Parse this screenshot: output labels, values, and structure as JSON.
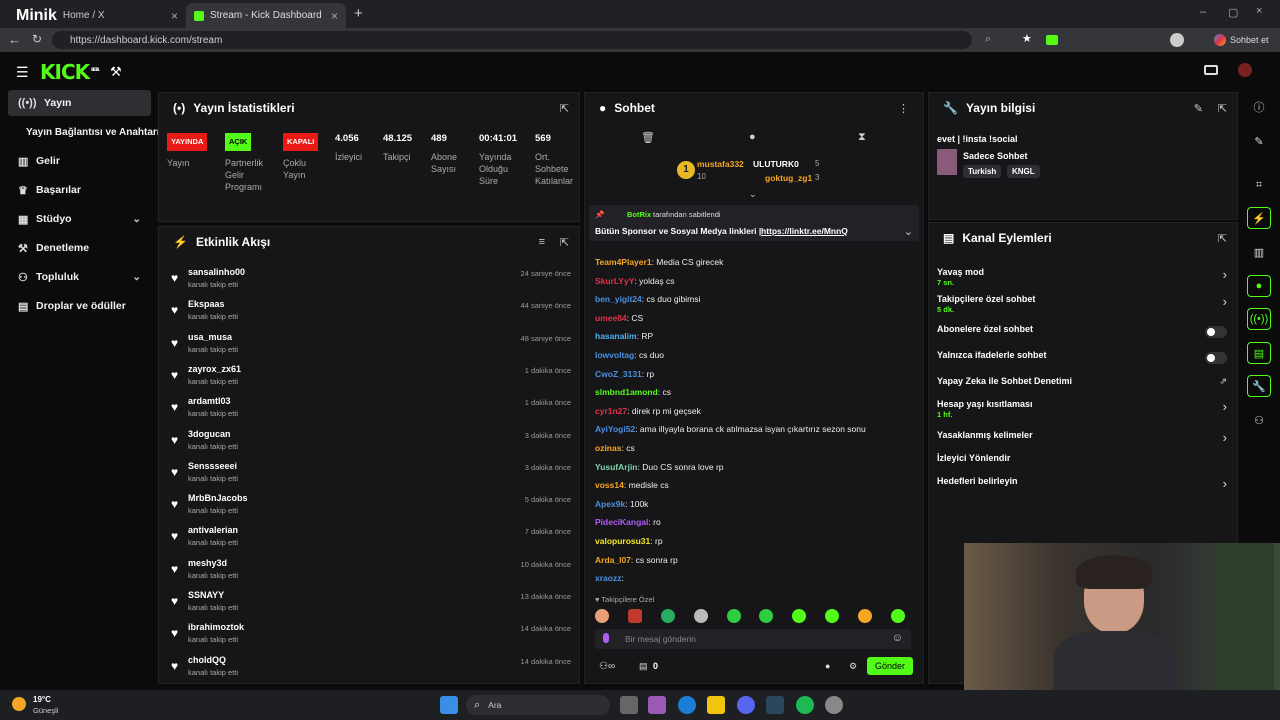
{
  "browser": {
    "tabs": [
      {
        "label": "Home / X",
        "overlay": "Minik"
      },
      {
        "label": "Stream - Kick Dashboard"
      }
    ],
    "url": "https://dashboard.kick.com/stream",
    "profile_label": "Sohbet et"
  },
  "header": {
    "logo": "KICK",
    "logo_badge": "BETA"
  },
  "sidebar": {
    "items": [
      {
        "label": "Yayın",
        "icon": "broadcast-icon"
      },
      {
        "label": "Yayın Bağlantısı ve Anahtarı",
        "icon": ""
      },
      {
        "label": "Gelir",
        "icon": "chart-icon"
      },
      {
        "label": "Başarılar",
        "icon": "trophy-icon"
      },
      {
        "label": "Stüdyo",
        "icon": "studio-icon"
      },
      {
        "label": "Denetleme",
        "icon": "hammer-icon"
      },
      {
        "label": "Topluluk",
        "icon": "community-icon"
      },
      {
        "label": "Droplar ve ödüller",
        "icon": "gift-icon"
      }
    ]
  },
  "stats": {
    "title": "Yayın İstatistikleri",
    "items": [
      {
        "badge": "YAYINDA",
        "label": "Yayın"
      },
      {
        "badge": "AÇIK",
        "label": "Partnerlik Gelir Programı"
      },
      {
        "badge": "KAPALI",
        "label": "Çoklu Yayın"
      },
      {
        "value": "4.056",
        "label": "İzleyici"
      },
      {
        "value": "48.125",
        "label": "Takipçi"
      },
      {
        "value": "489",
        "label": "Abone Sayısı"
      },
      {
        "value": "00:41:01",
        "label": "Yayında Olduğu Süre"
      },
      {
        "value": "569",
        "label": "Ort. Sohbete Katılanlar"
      }
    ]
  },
  "activity": {
    "title": "Etkinlik Akışı",
    "subtext": "kanalı takip etti",
    "events": [
      {
        "name": "sansalinho00",
        "time": "24 saniye önce"
      },
      {
        "name": "Ekspaas",
        "time": "44 saniye önce"
      },
      {
        "name": "usa_musa",
        "time": "48 saniye önce"
      },
      {
        "name": "zayrox_zx61",
        "time": "1 dakika önce"
      },
      {
        "name": "ardamtl03",
        "time": "1 dakika önce"
      },
      {
        "name": "3dogucan",
        "time": "3 dakika önce"
      },
      {
        "name": "Senssseeei",
        "time": "3 dakika önce"
      },
      {
        "name": "MrbBnJacobs",
        "time": "5 dakika önce"
      },
      {
        "name": "antivalerian",
        "time": "7 dakika önce"
      },
      {
        "name": "meshy3d",
        "time": "10 dakika önce"
      },
      {
        "name": "SSNAYY",
        "time": "13 dakika önce"
      },
      {
        "name": "ibrahimoztok",
        "time": "14 dakika önce"
      },
      {
        "name": "choldQQ",
        "time": "14 dakika önce"
      }
    ]
  },
  "chat": {
    "title": "Sohbet",
    "leaders": [
      {
        "name": "mustafa332",
        "count": "10",
        "rank": "1"
      },
      {
        "name": "ULUTURK0",
        "count": "5"
      },
      {
        "name": "goktug_zg1",
        "count": "3"
      }
    ],
    "pinned": {
      "by": "BotRix",
      "by_suffix": "tarafından sabitlendi",
      "text": "Bütün Sponsor ve Sosyal Medya linkleri |",
      "link": "https://linktr.ee/MnnQ"
    },
    "messages": [
      {
        "user": "Team4Player1",
        "color": "#f5a623",
        "text": "Media CS girecek"
      },
      {
        "user": "SkurLYyY",
        "color": "#e0304a",
        "text": "yoldaş cs"
      },
      {
        "user": "ben_yigit24",
        "color": "#4a90e2",
        "text": "cs duo gibimsi"
      },
      {
        "user": "umee84",
        "color": "#e0304a",
        "text": "CS"
      },
      {
        "user": "hasanalim",
        "color": "#4ab3f4",
        "text": "RP"
      },
      {
        "user": "lowvoltag",
        "color": "#4a90e2",
        "text": "cs duo"
      },
      {
        "user": "CwoZ_3131",
        "color": "#4a90e2",
        "text": "rp"
      },
      {
        "user": "slmbnd1amond",
        "color": "#53fc18",
        "text": "cs"
      },
      {
        "user": "cyr1n27",
        "color": "#e0304a",
        "text": "direk rp mi geçsek"
      },
      {
        "user": "AyiYogi52",
        "color": "#4a90e2",
        "text": "ama illyayla borana ck atılmazsa isyan çıkartırız sezon sonu"
      },
      {
        "user": "ozinas",
        "color": "#f5a623",
        "text": "cs"
      },
      {
        "user": "YusufArjin",
        "color": "#7ed3a8",
        "text": "Duo CS sonra love rp"
      },
      {
        "user": "voss14",
        "color": "#f5a623",
        "text": "medisle cs"
      },
      {
        "user": "Apex9k",
        "color": "#4a90e2",
        "text": "100k"
      },
      {
        "user": "PideciKangal",
        "color": "#b05cf5",
        "text": "ro"
      },
      {
        "user": "valopurosu31",
        "color": "#f5e623",
        "text": "rp"
      },
      {
        "user": "Arda_l07",
        "color": "#f5a623",
        "text": "cs sonra rp"
      },
      {
        "user": "xraozz",
        "color": "#4a90e2",
        "text": ""
      }
    ],
    "followers_only": "Takipçilere Özel",
    "placeholder": "Bir mesaj gönderin",
    "viewer_count": "0",
    "send_label": "Gönder"
  },
  "info": {
    "title": "Yayın bilgisi",
    "stream_title": "evet | !insta !social",
    "category": "Sadece Sohbet",
    "tags": [
      "Turkish",
      "KNGL"
    ]
  },
  "actions": {
    "title": "Kanal Eylemleri",
    "items": [
      {
        "label": "Yavaş mod",
        "sub": "7 sn."
      },
      {
        "label": "Takipçilere özel sohbet",
        "sub": "5 dk."
      },
      {
        "label": "Abonelere özel sohbet",
        "sub": ""
      },
      {
        "label": "Yalnızca ifadelerle sohbet",
        "sub": ""
      },
      {
        "label": "Yapay Zeka ile Sohbet Denetimi",
        "sub": ""
      },
      {
        "label": "Hesap yaşı kısıtlaması",
        "sub": "1 hf."
      },
      {
        "label": "Yasaklanmış kelimeler",
        "sub": ""
      },
      {
        "label": "İzleyici Yönlendir",
        "sub": ""
      },
      {
        "label": "Hedefleri belirleyin",
        "sub": ""
      }
    ]
  },
  "taskbar": {
    "weather_temp": "19°C",
    "weather_desc": "Güneşli",
    "search_label": "Ara"
  },
  "colors": {
    "brand": "#53fc18",
    "live": "#e91916",
    "panel": "#161618"
  }
}
